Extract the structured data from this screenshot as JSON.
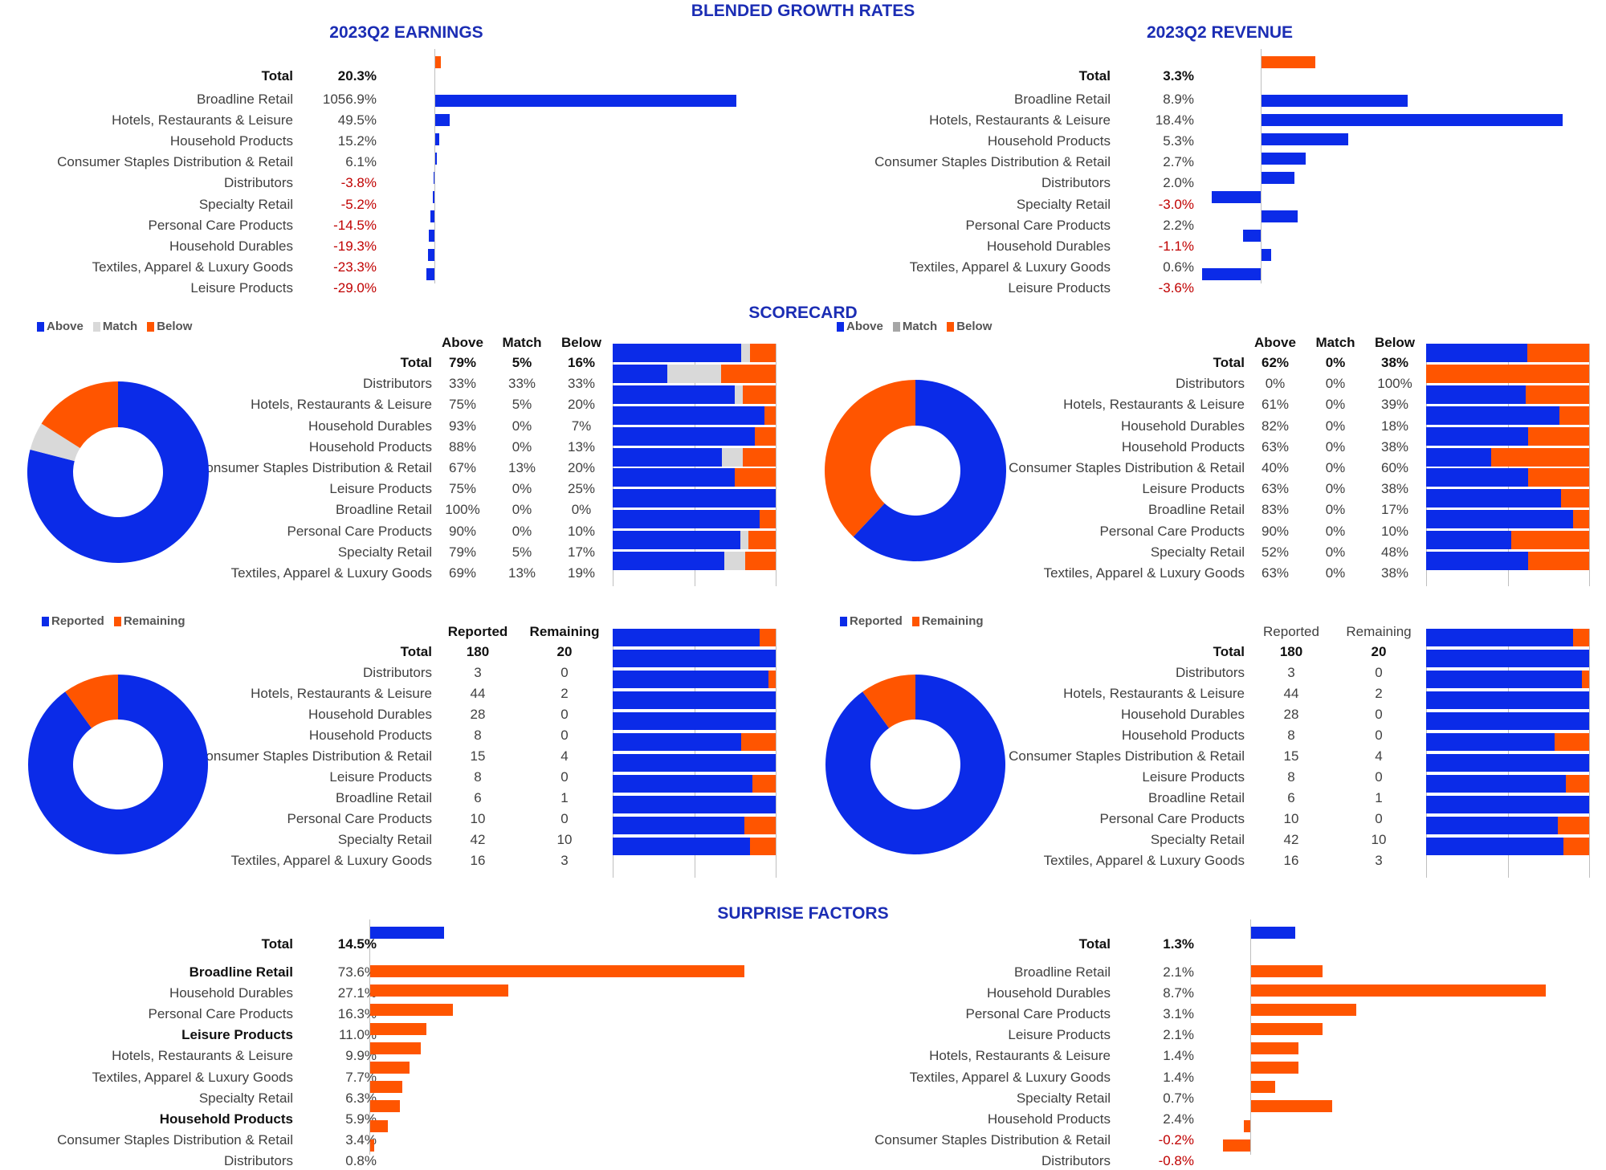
{
  "headings": {
    "blended": "BLENDED GROWTH RATES",
    "scorecard": "SCORECARD",
    "surprise": "SURPRISE FACTORS"
  },
  "chart_data": [
    {
      "type": "bar",
      "orientation": "horizontal",
      "title": "2023Q2 EARNINGS",
      "categories": [
        "Total",
        "Broadline Retail",
        "Hotels, Restaurants & Leisure",
        "Household Products",
        "Consumer Staples Distribution & Retail",
        "Distributors",
        "Specialty Retail",
        "Personal Care Products",
        "Household Durables",
        "Textiles, Apparel & Luxury Goods",
        "Leisure Products"
      ],
      "values": [
        20.3,
        1056.9,
        49.5,
        15.2,
        6.1,
        -3.8,
        -5.2,
        -14.5,
        -19.3,
        -23.3,
        -29.0
      ],
      "value_labels": [
        "20.3%",
        "1056.9%",
        "49.5%",
        "15.2%",
        "6.1%",
        "-3.8%",
        "-5.2%",
        "-14.5%",
        "-19.3%",
        "-23.3%",
        "-29.0%"
      ],
      "colors": {
        "total": "#FF5500",
        "categories": "#0B2BE8"
      }
    },
    {
      "type": "bar",
      "orientation": "horizontal",
      "title": "2023Q2 REVENUE",
      "categories": [
        "Total",
        "Broadline Retail",
        "Hotels, Restaurants & Leisure",
        "Household Products",
        "Consumer Staples Distribution & Retail",
        "Distributors",
        "Specialty Retail",
        "Personal Care Products",
        "Household Durables",
        "Textiles, Apparel & Luxury Goods",
        "Leisure Products"
      ],
      "values": [
        3.3,
        8.9,
        18.4,
        5.3,
        2.7,
        2.0,
        -3.0,
        2.2,
        -1.1,
        0.6,
        -3.6
      ],
      "value_labels": [
        "3.3%",
        "8.9%",
        "18.4%",
        "5.3%",
        "2.7%",
        "2.0%",
        "-3.0%",
        "2.2%",
        "-1.1%",
        "0.6%",
        "-3.6%"
      ],
      "colors": {
        "total": "#FF5500",
        "categories": "#0B2BE8"
      }
    },
    {
      "type": "bar",
      "orientation": "horizontal",
      "stacked": true,
      "unit": "%",
      "legend": "top-left",
      "categories": [
        "Total",
        "Distributors",
        "Hotels, Restaurants & Leisure",
        "Household Durables",
        "Household Products",
        "Consumer Staples Distribution & Retail",
        "Leisure Products",
        "Broadline Retail",
        "Personal Care Products",
        "Specialty Retail",
        "Textiles, Apparel & Luxury Goods"
      ],
      "series": [
        {
          "name": "Above",
          "color": "#0B2BE8",
          "values": [
            79,
            33,
            75,
            93,
            88,
            67,
            75,
            100,
            90,
            79,
            69
          ]
        },
        {
          "name": "Match",
          "color": "#D9D9D9",
          "values": [
            5,
            33,
            5,
            0,
            0,
            13,
            0,
            0,
            0,
            5,
            13
          ]
        },
        {
          "name": "Below",
          "color": "#FF5500",
          "values": [
            16,
            33,
            20,
            7,
            13,
            20,
            25,
            0,
            10,
            17,
            19
          ]
        }
      ]
    },
    {
      "type": "bar",
      "orientation": "horizontal",
      "stacked": true,
      "unit": "%",
      "legend": "top-left",
      "categories": [
        "Total",
        "Distributors",
        "Hotels, Restaurants & Leisure",
        "Household Durables",
        "Household Products",
        "Consumer Staples Distribution & Retail",
        "Leisure Products",
        "Broadline Retail",
        "Personal Care Products",
        "Specialty Retail",
        "Textiles, Apparel & Luxury Goods"
      ],
      "series": [
        {
          "name": "Above",
          "color": "#0B2BE8",
          "values": [
            62,
            0,
            61,
            82,
            63,
            40,
            63,
            83,
            90,
            52,
            63
          ]
        },
        {
          "name": "Match",
          "color": "#A6A6A6",
          "values": [
            0,
            0,
            0,
            0,
            0,
            0,
            0,
            0,
            0,
            0,
            0
          ]
        },
        {
          "name": "Below",
          "color": "#FF5500",
          "values": [
            38,
            100,
            39,
            18,
            38,
            60,
            38,
            17,
            10,
            48,
            38
          ]
        }
      ]
    },
    {
      "type": "bar",
      "orientation": "horizontal",
      "stacked": true,
      "unit": "",
      "legend": "top-left",
      "categories": [
        "Total",
        "Distributors",
        "Hotels, Restaurants & Leisure",
        "Household Durables",
        "Household Products",
        "Consumer Staples Distribution & Retail",
        "Leisure Products",
        "Broadline Retail",
        "Personal Care Products",
        "Specialty Retail",
        "Textiles, Apparel & Luxury Goods"
      ],
      "series": [
        {
          "name": "Reported",
          "color": "#0B2BE8",
          "values": [
            180,
            3,
            44,
            28,
            8,
            15,
            8,
            6,
            10,
            42,
            16
          ]
        },
        {
          "name": "Remaining",
          "color": "#FF5500",
          "values": [
            20,
            0,
            2,
            0,
            0,
            4,
            0,
            1,
            0,
            10,
            3
          ]
        }
      ]
    },
    {
      "type": "bar",
      "orientation": "horizontal",
      "stacked": true,
      "unit": "",
      "legend": "top-left",
      "categories": [
        "Total",
        "Distributors",
        "Hotels, Restaurants & Leisure",
        "Household Durables",
        "Household Products",
        "Consumer Staples Distribution & Retail",
        "Leisure Products",
        "Broadline Retail",
        "Personal Care Products",
        "Specialty Retail",
        "Textiles, Apparel & Luxury Goods"
      ],
      "series": [
        {
          "name": "Reported",
          "color": "#0B2BE8",
          "values": [
            180,
            3,
            44,
            28,
            8,
            15,
            8,
            6,
            10,
            42,
            16
          ]
        },
        {
          "name": "Remaining",
          "color": "#FF5500",
          "values": [
            20,
            0,
            2,
            0,
            0,
            4,
            0,
            1,
            0,
            10,
            3
          ]
        }
      ]
    },
    {
      "type": "bar",
      "orientation": "horizontal",
      "categories": [
        "Total",
        "Broadline Retail",
        "Household Durables",
        "Personal Care Products",
        "Leisure Products",
        "Hotels, Restaurants & Leisure",
        "Textiles, Apparel & Luxury Goods",
        "Specialty Retail",
        "Household Products",
        "Consumer Staples Distribution & Retail",
        "Distributors"
      ],
      "values": [
        14.5,
        73.6,
        27.1,
        16.3,
        11.0,
        9.9,
        7.7,
        6.3,
        5.9,
        3.4,
        0.8
      ],
      "value_labels": [
        "14.5%",
        "73.6%",
        "27.1%",
        "16.3%",
        "11.0%",
        "9.9%",
        "7.7%",
        "6.3%",
        "5.9%",
        "3.4%",
        "0.8%"
      ],
      "highlighted": [
        true,
        true,
        false,
        false,
        true,
        false,
        false,
        false,
        true,
        false,
        false
      ],
      "colors": {
        "total": "#0B2BE8",
        "categories": "#FF5500"
      }
    },
    {
      "type": "bar",
      "orientation": "horizontal",
      "categories": [
        "Total",
        "Broadline Retail",
        "Household Durables",
        "Personal Care Products",
        "Leisure Products",
        "Hotels, Restaurants & Leisure",
        "Textiles, Apparel & Luxury Goods",
        "Specialty Retail",
        "Household Products",
        "Consumer Staples Distribution & Retail",
        "Distributors"
      ],
      "values": [
        1.3,
        2.1,
        8.7,
        3.1,
        2.1,
        1.4,
        1.4,
        0.7,
        2.4,
        -0.2,
        -0.8
      ],
      "value_labels": [
        "1.3%",
        "2.1%",
        "8.7%",
        "3.1%",
        "2.1%",
        "1.4%",
        "1.4%",
        "0.7%",
        "2.4%",
        "-0.2%",
        "-0.8%"
      ],
      "colors": {
        "total": "#0B2BE8",
        "categories": "#FF5500"
      }
    }
  ]
}
